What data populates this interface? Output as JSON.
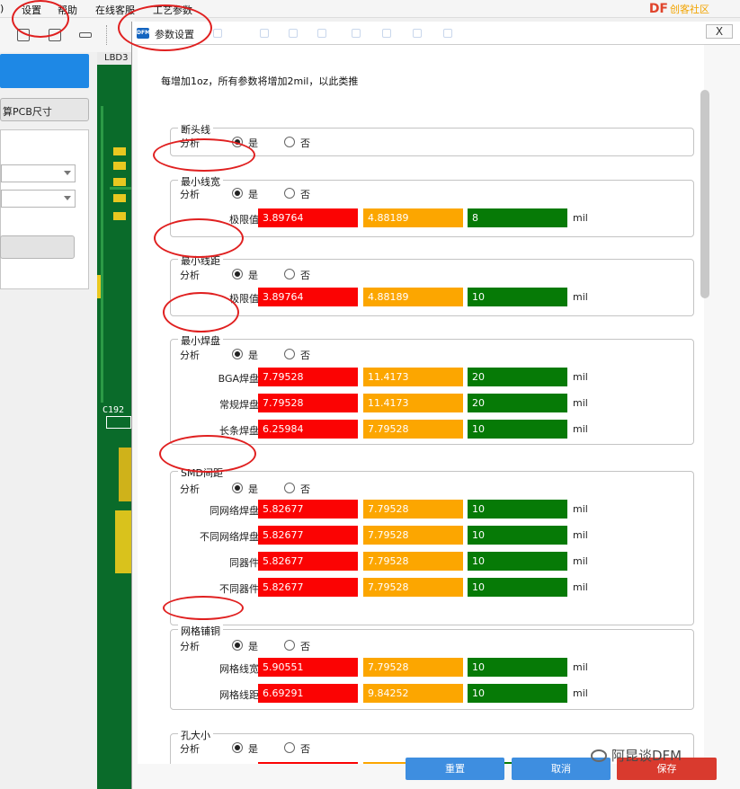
{
  "menu": {
    "fragment": ")",
    "settings": "设置",
    "help": "帮助",
    "service": "在线客服",
    "process": "工艺参数"
  },
  "logo": {
    "text": "DF",
    "sub": "创客社区"
  },
  "left": {
    "calc_pcb": "算PCB尺寸"
  },
  "pcb": {
    "tab": "LBD3",
    "label": "C192"
  },
  "dialog": {
    "icon": "DFM",
    "title": "参数设置",
    "close": "X",
    "note": "每增加1oz，所有参数将增加2mil，以此类推",
    "analyze": "分析",
    "yes": "是",
    "no": "否",
    "unit": "mil",
    "groups": [
      {
        "title": "断头线",
        "rows": []
      },
      {
        "title": "最小线宽",
        "rows": [
          {
            "label": "极限值",
            "red": "3.89764",
            "orange": "4.88189",
            "green": "8"
          }
        ]
      },
      {
        "title": "最小线距",
        "rows": [
          {
            "label": "极限值",
            "red": "3.89764",
            "orange": "4.88189",
            "green": "10"
          }
        ]
      },
      {
        "title": "最小焊盘",
        "rows": [
          {
            "label": "BGA焊盘",
            "red": "7.79528",
            "orange": "11.4173",
            "green": "20"
          },
          {
            "label": "常规焊盘",
            "red": "7.79528",
            "orange": "11.4173",
            "green": "20"
          },
          {
            "label": "长条焊盘",
            "red": "6.25984",
            "orange": "7.79528",
            "green": "10"
          }
        ]
      },
      {
        "title": "SMD间距",
        "rows": [
          {
            "label": "同网络焊盘",
            "red": "5.82677",
            "orange": "7.79528",
            "green": "10"
          },
          {
            "label": "不同网络焊盘",
            "red": "5.82677",
            "orange": "7.79528",
            "green": "10"
          },
          {
            "label": "同器件",
            "red": "5.82677",
            "orange": "7.79528",
            "green": "10"
          },
          {
            "label": "不同器件",
            "red": "5.82677",
            "orange": "7.79528",
            "green": "10"
          }
        ]
      },
      {
        "title": "网格铺铜",
        "rows": [
          {
            "label": "网格线宽",
            "red": "5.90551",
            "orange": "7.79528",
            "green": "10"
          },
          {
            "label": "网格线距",
            "red": "6.69291",
            "orange": "9.84252",
            "green": "10"
          }
        ]
      },
      {
        "title": "孔大小",
        "rows": []
      }
    ],
    "buttons": {
      "reset": "重置",
      "cancel": "取消",
      "save": "保存"
    }
  },
  "watermark": "阿昆谈DFM",
  "colors": {
    "red": "#fb0303",
    "orange": "#fca600",
    "green": "#067a06",
    "accent": "#3e8ee0",
    "save": "#d93a2e",
    "annotation": "#e02020"
  }
}
